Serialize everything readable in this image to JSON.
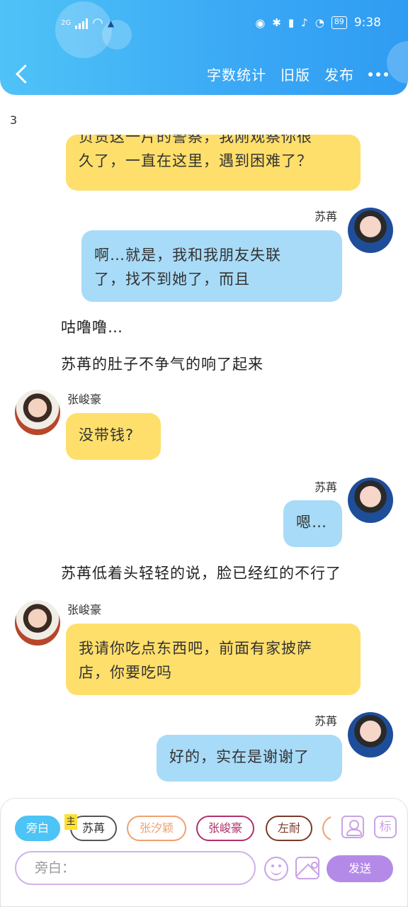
{
  "status_bar": {
    "network": "2G",
    "battery": "89",
    "time": "9:38"
  },
  "nav": {
    "word_count": "字数统计",
    "old_version": "旧版",
    "publish": "发布"
  },
  "chat": {
    "counter": "3",
    "messages": [
      {
        "side": "left",
        "color": "yellow",
        "text_line1": "负责这一片的警察，我刚观察你很",
        "text_line2": "久了，一直在这里，遇到困难了？"
      },
      {
        "side": "right",
        "color": "blue",
        "speaker": "苏苒",
        "text_line1": "啊…就是，我和我朋友失联",
        "text_line2": "了，找不到她了，而且"
      },
      {
        "type": "narration",
        "text": "咕噜噜…"
      },
      {
        "type": "narration",
        "text": "苏苒的肚子不争气的响了起来"
      },
      {
        "side": "left",
        "color": "yellow",
        "speaker": "张峻豪",
        "text": "没带钱?"
      },
      {
        "side": "right",
        "color": "blue",
        "speaker": "苏苒",
        "text": "嗯…"
      },
      {
        "type": "narration",
        "text": "苏苒低着头轻轻的说，脸已经红的不行了"
      },
      {
        "side": "left",
        "color": "yellow",
        "speaker": "张峻豪",
        "text_line1": "我请你吃点东西吧，前面有家披萨",
        "text_line2": "店，你要吃吗"
      },
      {
        "side": "right",
        "color": "blue",
        "speaker": "苏苒",
        "text": "好的，实在是谢谢了"
      }
    ]
  },
  "composer": {
    "main_tag": "主",
    "chips": [
      {
        "label": "旁白",
        "color": "#4ec3f5"
      },
      {
        "label": "苏苒",
        "color": "#555555"
      },
      {
        "label": "张汐颖",
        "color": "#f0a070"
      },
      {
        "label": "张峻豪",
        "color": "#b0306a"
      },
      {
        "label": "左耐",
        "color": "#7a3a2a"
      }
    ],
    "tag_icon_label": "标",
    "input_placeholder": "旁白：",
    "send_label": "发送"
  }
}
